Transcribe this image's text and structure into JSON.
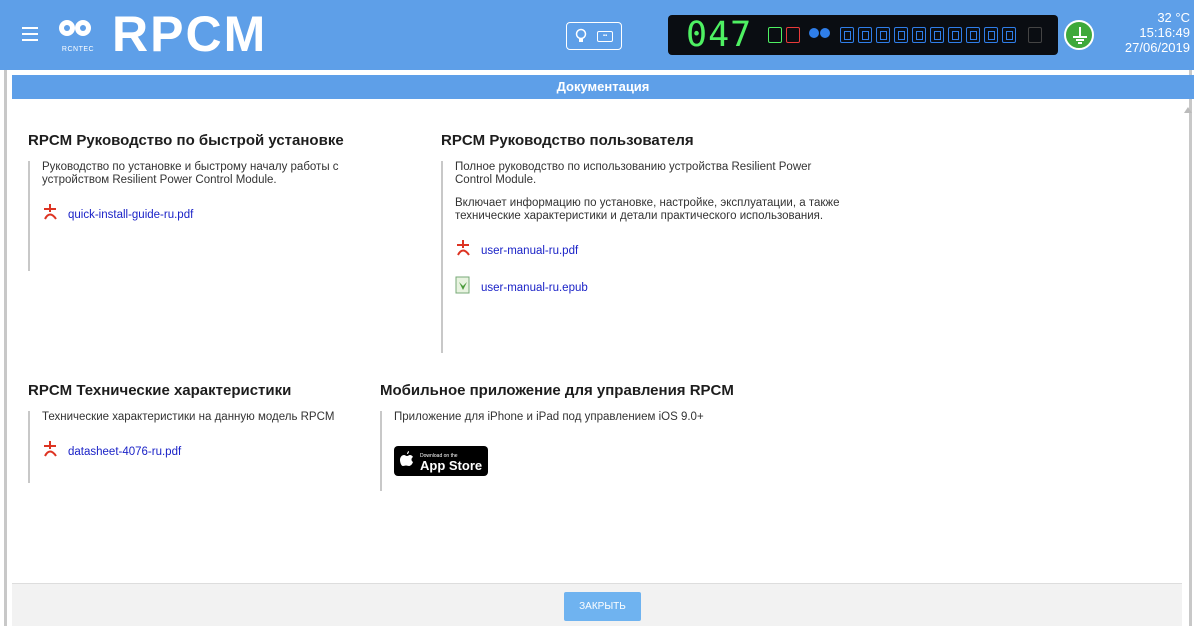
{
  "header": {
    "brand": "RPCM",
    "logo_sub": "RCNTEC",
    "counter": "047",
    "temperature": "32 °C",
    "time": "15:16:49",
    "date": "27/06/2019",
    "accent_color": "#5e9fe8"
  },
  "dialog": {
    "title": "Документация",
    "close_label": "ЗАКРЫТЬ"
  },
  "sections": {
    "quick": {
      "title": "RPCM Руководство по быстрой установке",
      "desc": "Руководство по установке и быстрому началу работы с устройством Resilient Power Control Module.",
      "file": "quick-install-guide-ru.pdf"
    },
    "manual": {
      "title": "RPCM Руководство пользователя",
      "desc1": "Полное руководство по использованию устройства Resilient Power Control Module.",
      "desc2": "Включает информацию по установке, настройке, эксплуатации, а также технические характеристики и детали практического использования.",
      "file_pdf": "user-manual-ru.pdf",
      "file_epub": "user-manual-ru.epub"
    },
    "specs": {
      "title": "RPCM Технические характеристики",
      "desc": "Технические характеристики на данную модель RPCM",
      "file": "datasheet-4076-ru.pdf"
    },
    "mobile": {
      "title": "Мобильное приложение для управления RPCM",
      "desc": "Приложение для iPhone и iPad под управлением iOS 9.0+",
      "store_small": "Download on the",
      "store_big": "App Store"
    }
  }
}
